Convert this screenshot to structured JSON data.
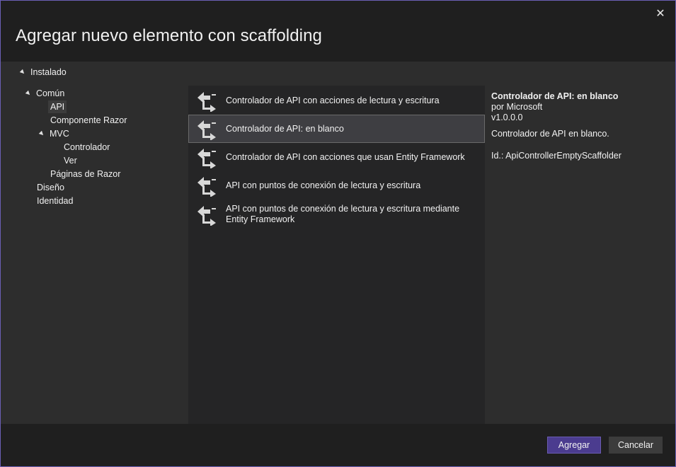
{
  "dialog": {
    "title": "Agregar nuevo elemento con scaffolding",
    "close_icon": "close-icon"
  },
  "tree": {
    "root_label": "Instalado",
    "items": [
      {
        "label": "Común",
        "level": 1,
        "expanded": true
      },
      {
        "label": "API",
        "level": 2,
        "selected": true
      },
      {
        "label": "Componente Razor",
        "level": 2
      },
      {
        "label": "MVC",
        "level": 2,
        "expanded": true
      },
      {
        "label": "Controlador",
        "level": 3
      },
      {
        "label": "Ver",
        "level": 3
      },
      {
        "label": "Páginas de Razor",
        "level": 2
      },
      {
        "label": "Diseño",
        "level": 1
      },
      {
        "label": "Identidad",
        "level": 1
      }
    ]
  },
  "templates": [
    {
      "label": "Controlador de API con acciones de lectura y escritura",
      "icon": "api-controller-icon"
    },
    {
      "label": "Controlador de API: en blanco",
      "icon": "api-controller-icon",
      "selected": true
    },
    {
      "label": "Controlador de API con acciones que usan Entity Framework",
      "icon": "api-controller-icon"
    },
    {
      "label": "API con puntos de conexión de lectura y escritura",
      "icon": "api-controller-icon"
    },
    {
      "label": "API con puntos de conexión de lectura y escritura mediante Entity Framework",
      "icon": "api-controller-icon"
    }
  ],
  "details": {
    "title": "Controlador de API: en blanco",
    "author": "por Microsoft",
    "version": "v1.0.0.0",
    "description": "Controlador de API en blanco.",
    "id": "Id.: ApiControllerEmptyScaffolder"
  },
  "footer": {
    "add_label": "Agregar",
    "cancel_label": "Cancelar"
  },
  "colors": {
    "accent": "#4b3c8f",
    "border": "#6b5fb5",
    "pane_bg": "#2d2d2d",
    "list_bg": "#252526"
  }
}
